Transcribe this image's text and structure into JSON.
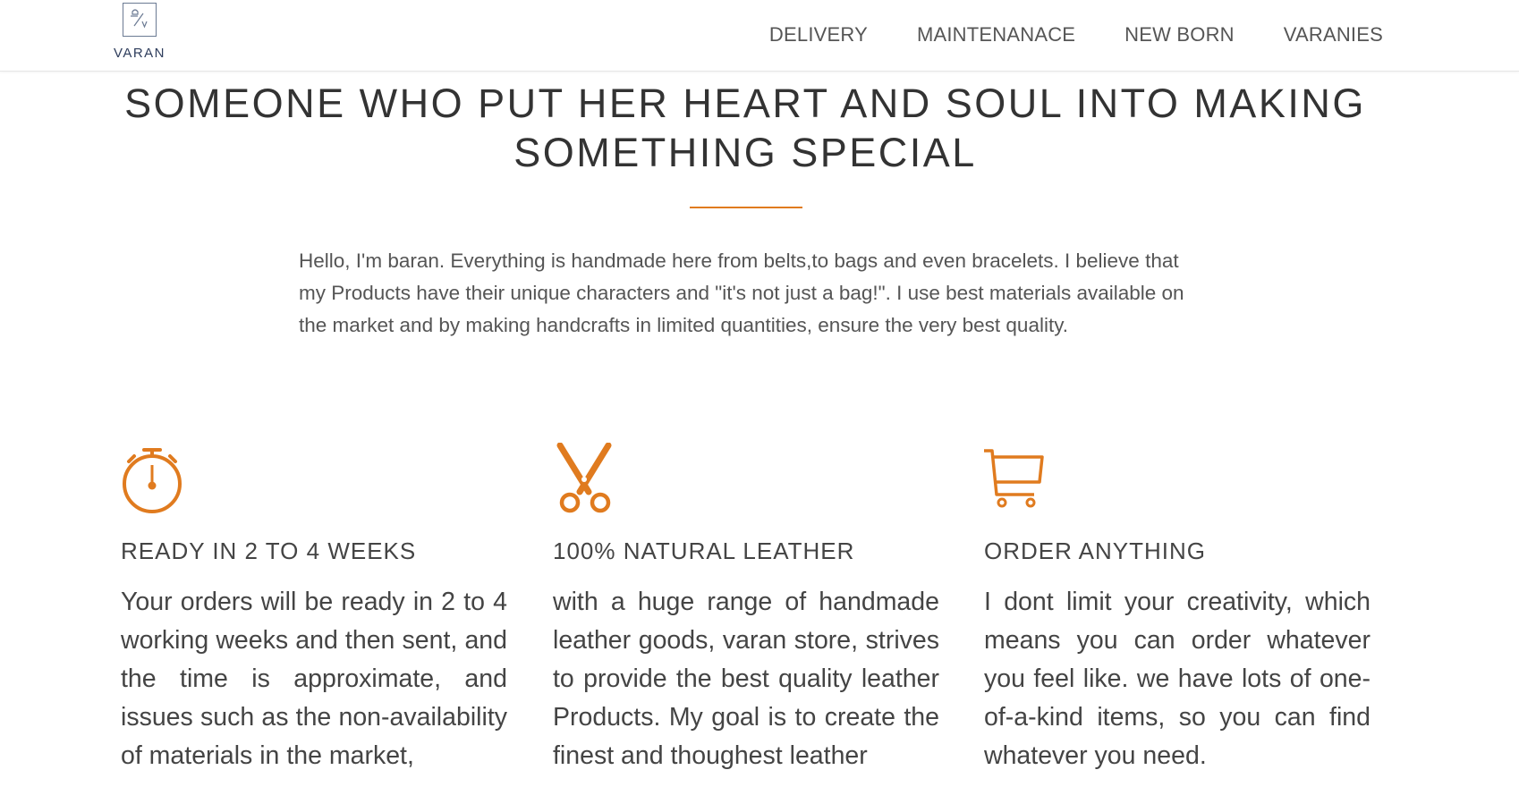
{
  "header": {
    "logo_label": "VARAN",
    "nav": [
      "DELIVERY",
      "MAINTENANACE",
      "NEW BORN",
      "VARANIES"
    ]
  },
  "hero": {
    "title_line1": "SOMEONE WHO PUT HER HEART AND SOUL INTO MAKING",
    "title_line2": "SOMETHING SPECIAL"
  },
  "intro": {
    "text": "Hello, I'm baran. Everything is handmade here from belts,to bags and even bracelets. I believe that my Products have their unique characters and \"it's not just a bag!\". I use best materials available on the market and by making handcrafts in limited quantities, ensure the very best quality."
  },
  "features": [
    {
      "icon": "stopwatch-icon",
      "title": "READY IN 2 TO 4 WEEKS",
      "text": "Your orders will be ready in 2 to 4 working weeks and then sent, and the time is approximate, and issues such as the non-availability of materials in the market,"
    },
    {
      "icon": "scissors-icon",
      "title": "100% NATURAL LEATHER",
      "text": "with a huge range of handmade leather goods, varan store, strives to provide the best quality leather Products. My goal is to create the finest and thoughest leather"
    },
    {
      "icon": "shopping-cart-icon",
      "title": "ORDER ANYTHING",
      "text": "I dont limit your creativity, which means you can order whatever you feel like. we have lots of one-of-a-kind items, so you can find whatever you need."
    }
  ],
  "colors": {
    "accent": "#e07b1f",
    "logo": "#2e3d5c"
  }
}
